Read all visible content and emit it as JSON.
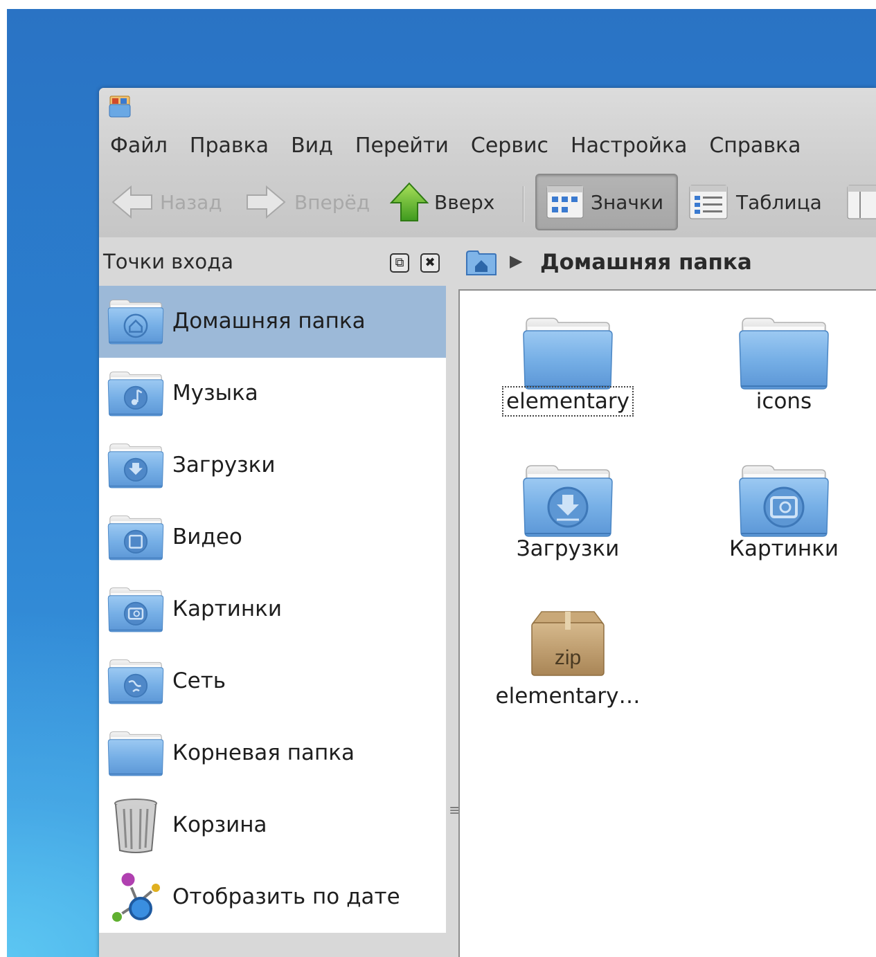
{
  "menubar": {
    "items": [
      "Файл",
      "Правка",
      "Вид",
      "Перейти",
      "Сервис",
      "Настройка",
      "Справка"
    ]
  },
  "toolbar": {
    "back": "Назад",
    "forward": "Вперёд",
    "up": "Вверх",
    "icons_view": "Значки",
    "table_view": "Таблица"
  },
  "sidebar": {
    "title": "Точки входа",
    "items": [
      {
        "label": "Домашняя папка",
        "icon": "home-folder-icon",
        "selected": true
      },
      {
        "label": "Музыка",
        "icon": "music-folder-icon"
      },
      {
        "label": "Загрузки",
        "icon": "downloads-folder-icon"
      },
      {
        "label": "Видео",
        "icon": "video-folder-icon"
      },
      {
        "label": "Картинки",
        "icon": "pictures-folder-icon"
      },
      {
        "label": "Сеть",
        "icon": "network-folder-icon"
      },
      {
        "label": "Корневая папка",
        "icon": "root-folder-icon"
      },
      {
        "label": "Корзина",
        "icon": "trash-icon"
      },
      {
        "label": "Отобразить по дате",
        "icon": "timeline-icon"
      }
    ]
  },
  "breadcrumb": {
    "current": "Домашняя папка"
  },
  "files": [
    {
      "label": "elementary",
      "icon": "folder-icon",
      "focused": true
    },
    {
      "label": "icons",
      "icon": "folder-icon"
    },
    {
      "label": "Загрузки",
      "icon": "downloads-folder-icon"
    },
    {
      "label": "Картинки",
      "icon": "pictures-folder-icon"
    },
    {
      "label": "elementary…",
      "icon": "zip-archive-icon"
    }
  ],
  "colors": {
    "selection": "#9cb9d8",
    "folder": "#6aa3dd",
    "desktop": "#2b7fcf"
  }
}
